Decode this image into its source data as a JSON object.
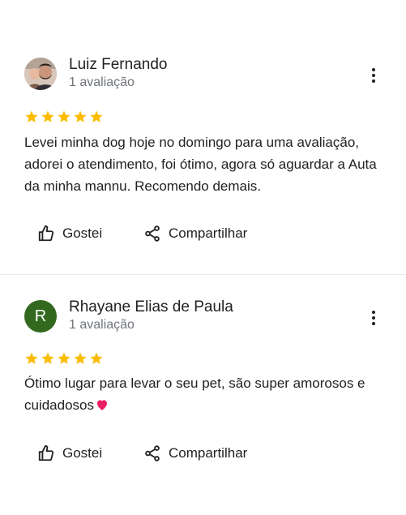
{
  "reviews": [
    {
      "author": "Luiz Fernando",
      "review_count": "1 avaliação",
      "avatar_type": "photo",
      "avatar_letter": "",
      "rating": 5,
      "text": "Levei minha dog hoje no domingo para uma avaliação, adorei o atendimento, foi ótimo, agora só aguardar a Auta da minha mannu. Recomendo demais.",
      "like_label": "Gostei",
      "share_label": "Compartilhar"
    },
    {
      "author": "Rhayane Elias de Paula",
      "review_count": "1 avaliação",
      "avatar_type": "letter",
      "avatar_letter": "R",
      "avatar_color": "#33691e",
      "rating": 5,
      "text": "Ótimo lugar para levar o seu pet, são super amorosos e cuidadosos",
      "text_emoji": "heart-emoji",
      "like_label": "Gostei",
      "share_label": "Compartilhar"
    }
  ],
  "colors": {
    "star": "#fbbc04",
    "secondary_text": "#70757a",
    "divider": "#e8eaed",
    "heart": "#e91e63"
  }
}
